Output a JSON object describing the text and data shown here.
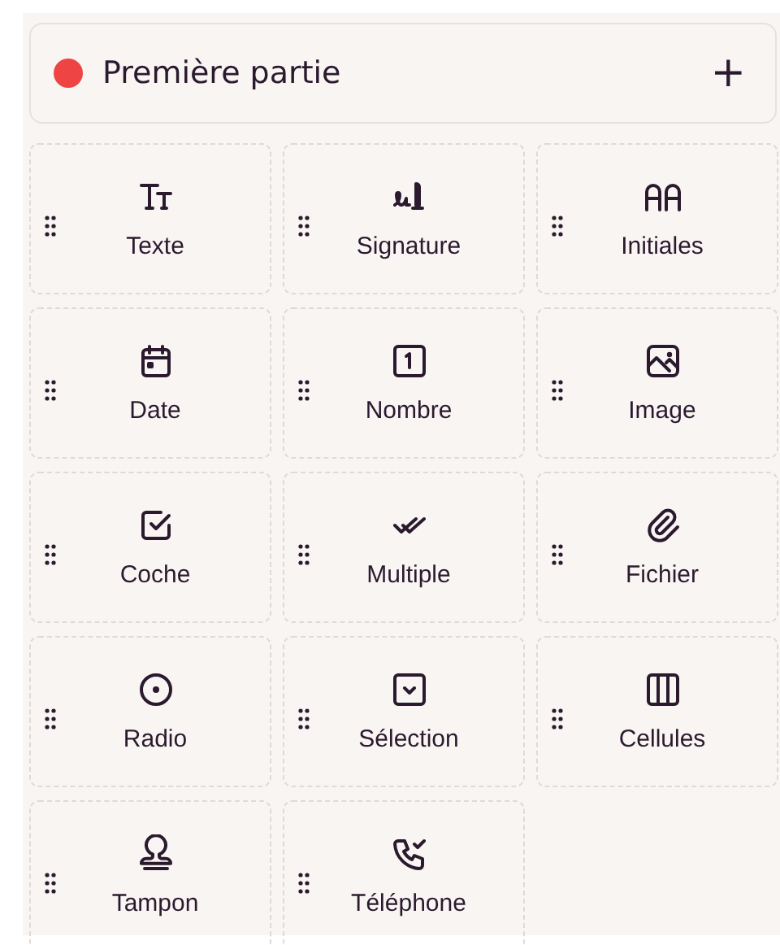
{
  "party": {
    "name": "Première partie",
    "color": "#ef4444",
    "add_label": "+"
  },
  "fields": [
    {
      "kind": "text",
      "label": "Texte"
    },
    {
      "kind": "signature",
      "label": "Signature"
    },
    {
      "kind": "initials",
      "label": "Initiales"
    },
    {
      "kind": "date",
      "label": "Date"
    },
    {
      "kind": "number",
      "label": "Nombre"
    },
    {
      "kind": "image",
      "label": "Image"
    },
    {
      "kind": "checkbox",
      "label": "Coche"
    },
    {
      "kind": "multiple",
      "label": "Multiple"
    },
    {
      "kind": "file",
      "label": "Fichier"
    },
    {
      "kind": "radio",
      "label": "Radio"
    },
    {
      "kind": "select",
      "label": "Sélection"
    },
    {
      "kind": "cells",
      "label": "Cellules"
    },
    {
      "kind": "stamp",
      "label": "Tampon"
    },
    {
      "kind": "phone",
      "label": "Téléphone"
    }
  ]
}
